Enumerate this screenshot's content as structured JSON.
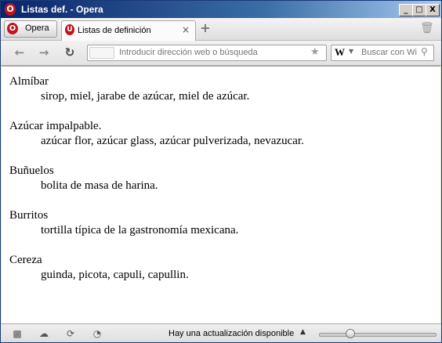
{
  "window": {
    "title": "Listas def. - Opera"
  },
  "controls": {
    "minimize": "_",
    "maximize": "□",
    "close": "X"
  },
  "menu": {
    "label": "Opera"
  },
  "tabs": [
    {
      "label": "Listas de definición",
      "close": "×"
    }
  ],
  "address": {
    "placeholder": "Introducir dirección web o búsqueda"
  },
  "search": {
    "engine": "W",
    "placeholder": "Buscar con Wi"
  },
  "definitions": [
    {
      "term": "Almíbar",
      "definition": "sirop, miel, jarabe de azúcar, miel de azúcar."
    },
    {
      "term": "Azúcar impalpable.",
      "definition": "azúcar flor, azúcar glass, azúcar pulverizada, nevazucar."
    },
    {
      "term": "Buñuelos",
      "definition": "bolita de masa de harina."
    },
    {
      "term": "Burritos",
      "definition": "tortilla típica de la gastronomía mexicana."
    },
    {
      "term": "Cereza",
      "definition": "guinda, picota, capuli, capullin."
    }
  ],
  "status": {
    "update_text": "Hay una actualización disponible"
  },
  "zoom": {
    "level_fraction": 0.27
  },
  "colors": {
    "opera_red": "#c0141c",
    "titlebar": "#0a246a"
  }
}
